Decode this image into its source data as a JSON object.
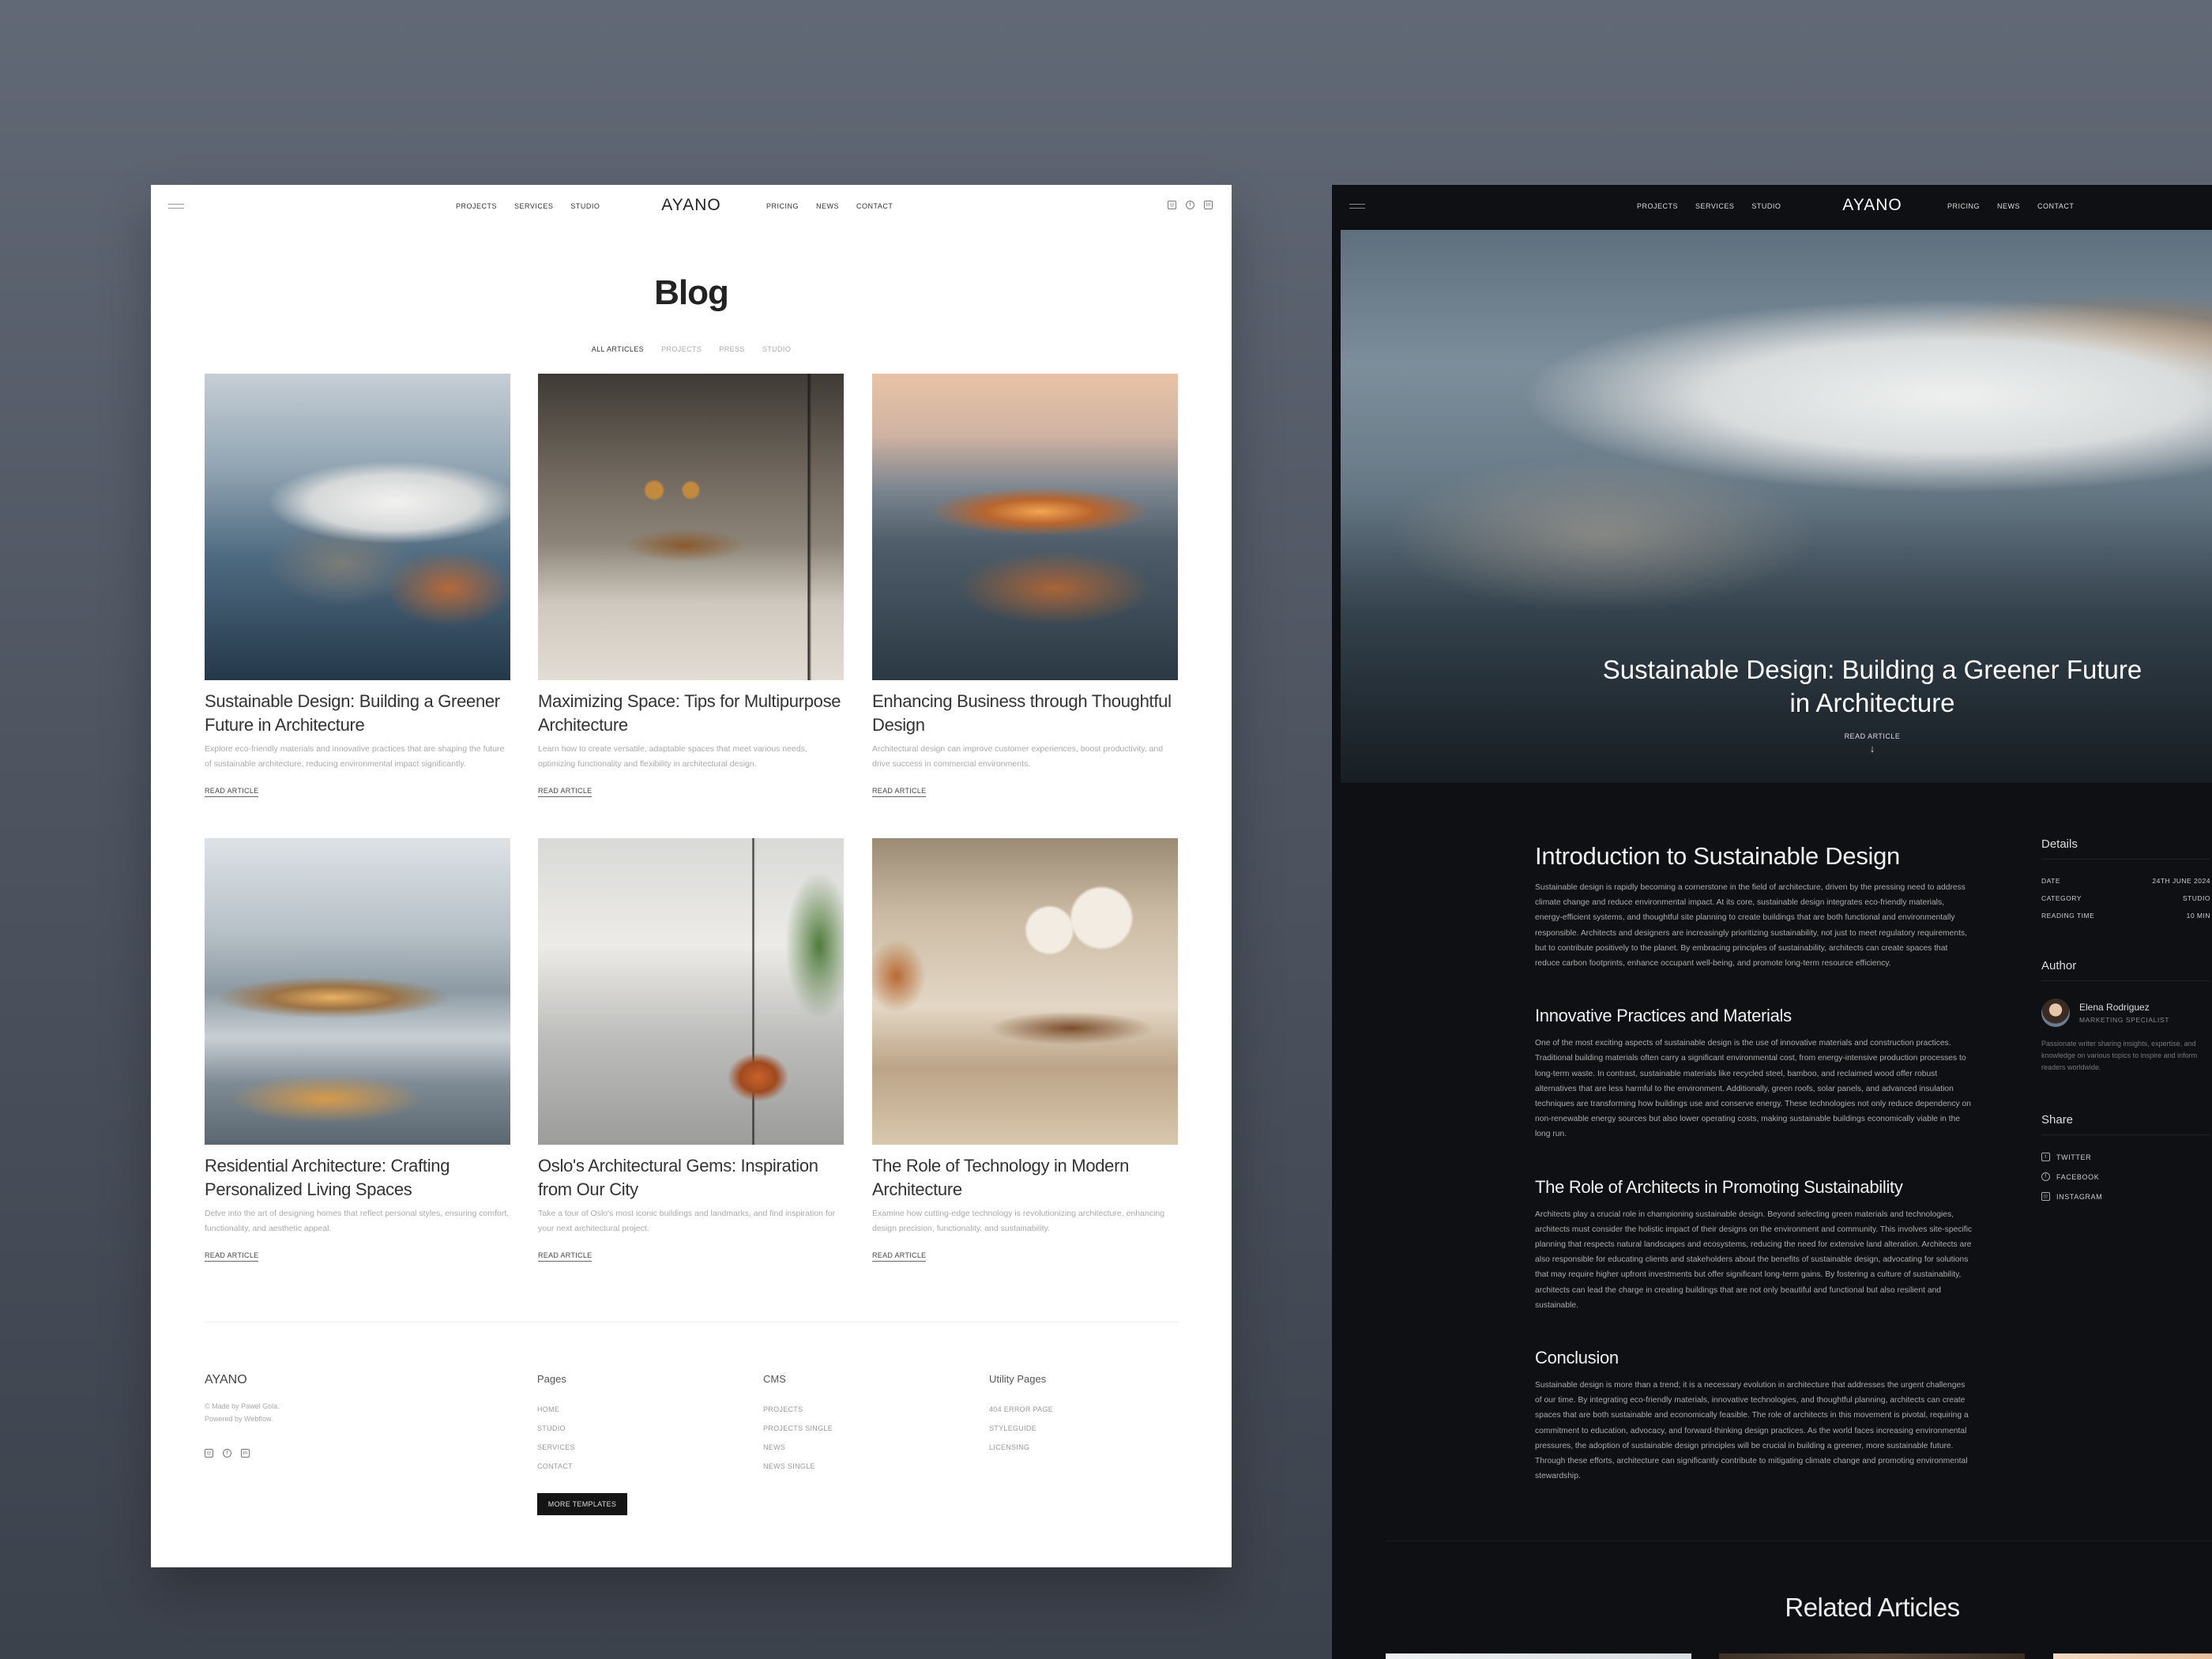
{
  "nav": {
    "logo": "AYANO",
    "left_links": [
      "PROJECTS",
      "SERVICES",
      "STUDIO"
    ],
    "right_links": [
      "PRICING",
      "NEWS",
      "CONTACT"
    ],
    "social_icons": [
      "instagram-icon",
      "facebook-icon",
      "linkedin-icon"
    ]
  },
  "blog": {
    "title": "Blog",
    "filters": [
      "ALL ARTICLES",
      "PROJECTS",
      "PRESS",
      "STUDIO"
    ],
    "active_filter": "ALL ARTICLES",
    "read_label": "READ ARTICLE",
    "cards": [
      {
        "title": "Sustainable Design: Building a Greener Future in Architecture",
        "desc": "Explore eco-friendly materials and innovative practices that are shaping the future of sustainable architecture, reducing environmental impact significantly."
      },
      {
        "title": "Maximizing Space: Tips for Multipurpose Architecture",
        "desc": "Learn how to create versatile, adaptable spaces that meet various needs, optimizing functionality and flexibility in architectural design."
      },
      {
        "title": "Enhancing Business through Thoughtful Design",
        "desc": "Architectural design can improve customer experiences, boost productivity, and drive success in commercial environments."
      },
      {
        "title": "Residential Architecture: Crafting Personalized Living Spaces",
        "desc": "Delve into the art of designing homes that reflect personal styles, ensuring comfort, functionality, and aesthetic appeal."
      },
      {
        "title": "Oslo's Architectural Gems: Inspiration from Our City",
        "desc": "Take a tour of Oslo's most iconic buildings and landmarks, and find inspiration for your next architectural project."
      },
      {
        "title": "The Role of Technology in Modern Architecture",
        "desc": "Examine how cutting-edge technology is revolutionizing architecture, enhancing design precision, functionality, and sustainability."
      }
    ]
  },
  "footer": {
    "logo": "AYANO",
    "copy_1": "© Made by Pawel Gola.",
    "copy_2": "Powered by Webflow.",
    "pages": {
      "title": "Pages",
      "links": [
        "HOME",
        "STUDIO",
        "SERVICES",
        "CONTACT"
      ]
    },
    "cms": {
      "title": "CMS",
      "links": [
        "PROJECTS",
        "PROJECTS SINGLE",
        "NEWS",
        "NEWS SINGLE"
      ]
    },
    "utility": {
      "title": "Utility Pages",
      "links": [
        "404 ERROR PAGE",
        "STYLEGUIDE",
        "LICENSING"
      ]
    },
    "more_button": "MORE TEMPLATES"
  },
  "article": {
    "hero_title": "Sustainable Design: Building a Greener Future in Architecture",
    "hero_read": "READ ARTICLE",
    "hero_arrow": "↓",
    "sections": [
      {
        "heading": "Introduction to Sustainable Design",
        "body": "Sustainable design is rapidly becoming a cornerstone in the field of architecture, driven by the pressing need to address climate change and reduce environmental impact. At its core, sustainable design integrates eco-friendly materials, energy-efficient systems, and thoughtful site planning to create buildings that are both functional and environmentally responsible. Architects and designers are increasingly prioritizing sustainability, not just to meet regulatory requirements, but to contribute positively to the planet. By embracing principles of sustainability, architects can create spaces that reduce carbon footprints, enhance occupant well-being, and promote long-term resource efficiency."
      },
      {
        "heading": "Innovative Practices and Materials",
        "body": "One of the most exciting aspects of sustainable design is the use of innovative materials and construction practices. Traditional building materials often carry a significant environmental cost, from energy-intensive production processes to long-term waste. In contrast, sustainable materials like recycled steel, bamboo, and reclaimed wood offer robust alternatives that are less harmful to the environment. Additionally, green roofs, solar panels, and advanced insulation techniques are transforming how buildings use and conserve energy. These technologies not only reduce dependency on non-renewable energy sources but also lower operating costs, making sustainable buildings economically viable in the long run."
      },
      {
        "heading": "The Role of Architects in Promoting Sustainability",
        "body": "Architects play a crucial role in championing sustainable design. Beyond selecting green materials and technologies, architects must consider the holistic impact of their designs on the environment and community. This involves site-specific planning that respects natural landscapes and ecosystems, reducing the need for extensive land alteration. Architects are also responsible for educating clients and stakeholders about the benefits of sustainable design, advocating for solutions that may require higher upfront investments but offer significant long-term gains. By fostering a culture of sustainability, architects can lead the charge in creating buildings that are not only beautiful and functional but also resilient and sustainable."
      },
      {
        "heading": "Conclusion",
        "body": "Sustainable design is more than a trend; it is a necessary evolution in architecture that addresses the urgent challenges of our time. By integrating eco-friendly materials, innovative technologies, and thoughtful planning, architects can create spaces that are both sustainable and economically feasible. The role of architects in this movement is pivotal, requiring a commitment to education, advocacy, and forward-thinking design practices. As the world faces increasing environmental pressures, the adoption of sustainable design principles will be crucial in building a greener, more sustainable future. Through these efforts, architecture can significantly contribute to mitigating climate change and promoting environmental stewardship."
      }
    ],
    "details": {
      "title": "Details",
      "rows": [
        {
          "label": "DATE",
          "value": "24TH JUNE 2024"
        },
        {
          "label": "CATEGORY",
          "value": "STUDIO"
        },
        {
          "label": "READING TIME",
          "value": "10 MIN"
        }
      ]
    },
    "author": {
      "title": "Author",
      "name": "Elena Rodriguez",
      "role": "MARKETING SPECIALIST",
      "bio": "Passionate writer sharing insights, expertise, and knowledge on various topics to inspire and inform readers worldwide."
    },
    "share": {
      "title": "Share",
      "items": [
        {
          "label": "TWITTER",
          "icon": "twitter-icon"
        },
        {
          "label": "FACEBOOK",
          "icon": "facebook-icon"
        },
        {
          "label": "INSTAGRAM",
          "icon": "instagram-icon"
        }
      ]
    },
    "related_title": "Related Articles"
  }
}
